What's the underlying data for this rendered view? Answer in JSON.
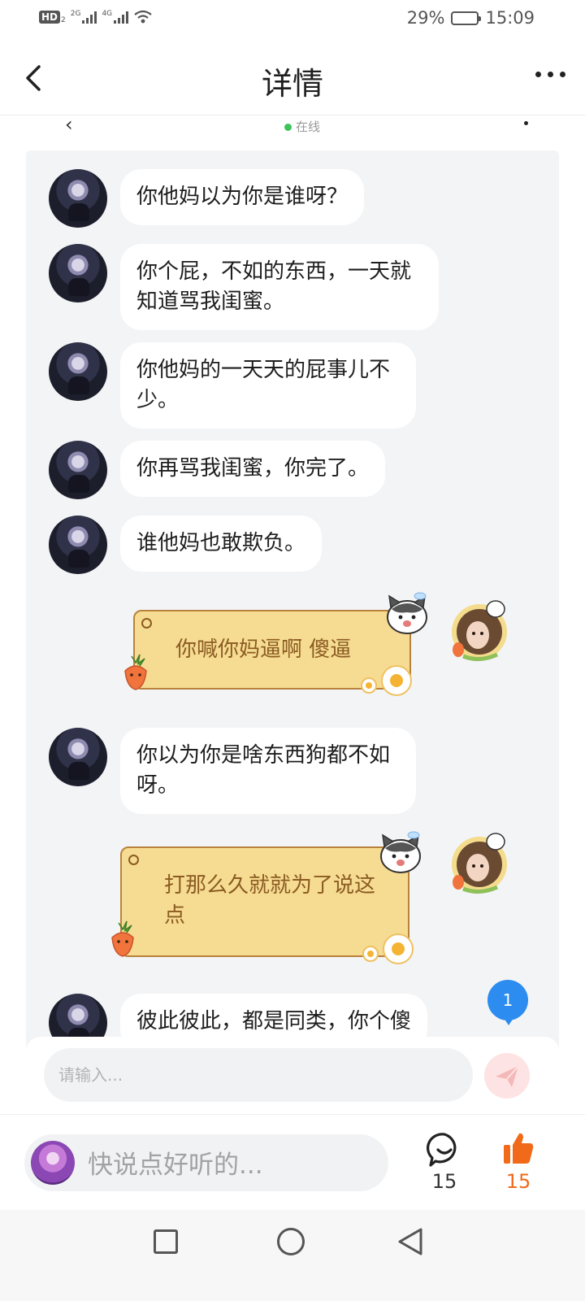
{
  "status_bar": {
    "hd_label": "HD",
    "hd_sub": "2",
    "net1_label": "2G",
    "net2_label": "4G",
    "battery_percent": "29%",
    "battery_level": 0.29,
    "time": "15:09"
  },
  "header": {
    "title": "详情"
  },
  "chat_header_partial": {
    "online_label": "在线"
  },
  "messages": [
    {
      "side": "left",
      "text": "你他妈以为你是谁呀？"
    },
    {
      "side": "left",
      "text": "你个屁，不如的东西，一天就知道骂我闺蜜。"
    },
    {
      "side": "left",
      "text": "你他妈的一天天的屁事儿不少。"
    },
    {
      "side": "left",
      "text": "你再骂我闺蜜，你完了。"
    },
    {
      "side": "left",
      "text": "谁他妈也敢欺负。"
    },
    {
      "side": "right",
      "text": "你喊你妈逼啊 傻逼"
    },
    {
      "side": "left",
      "text": "你以为你是啥东西狗都不如呀。"
    },
    {
      "side": "right",
      "text": "打那么久就就为了说这点"
    },
    {
      "side": "left",
      "text": "彼此彼此，都是同类，你个傻"
    }
  ],
  "unread_badge": {
    "count": "1"
  },
  "message_input": {
    "placeholder": "请输入..."
  },
  "comment_bar": {
    "placeholder": "快说点好听的...",
    "comment_count": "15",
    "like_count": "15"
  },
  "colors": {
    "accent_orange": "#f06a1a",
    "online_green": "#3bc45a",
    "badge_blue": "#2d8cf0",
    "deco_bubble": "#f6dc92"
  },
  "icons": {
    "back": "chevron-left-icon",
    "more": "more-dots-icon",
    "send": "send-icon",
    "comment": "comment-bubble-icon",
    "like": "thumbs-up-icon",
    "nav_recent": "square-icon",
    "nav_home": "circle-icon",
    "nav_back": "triangle-back-icon"
  }
}
